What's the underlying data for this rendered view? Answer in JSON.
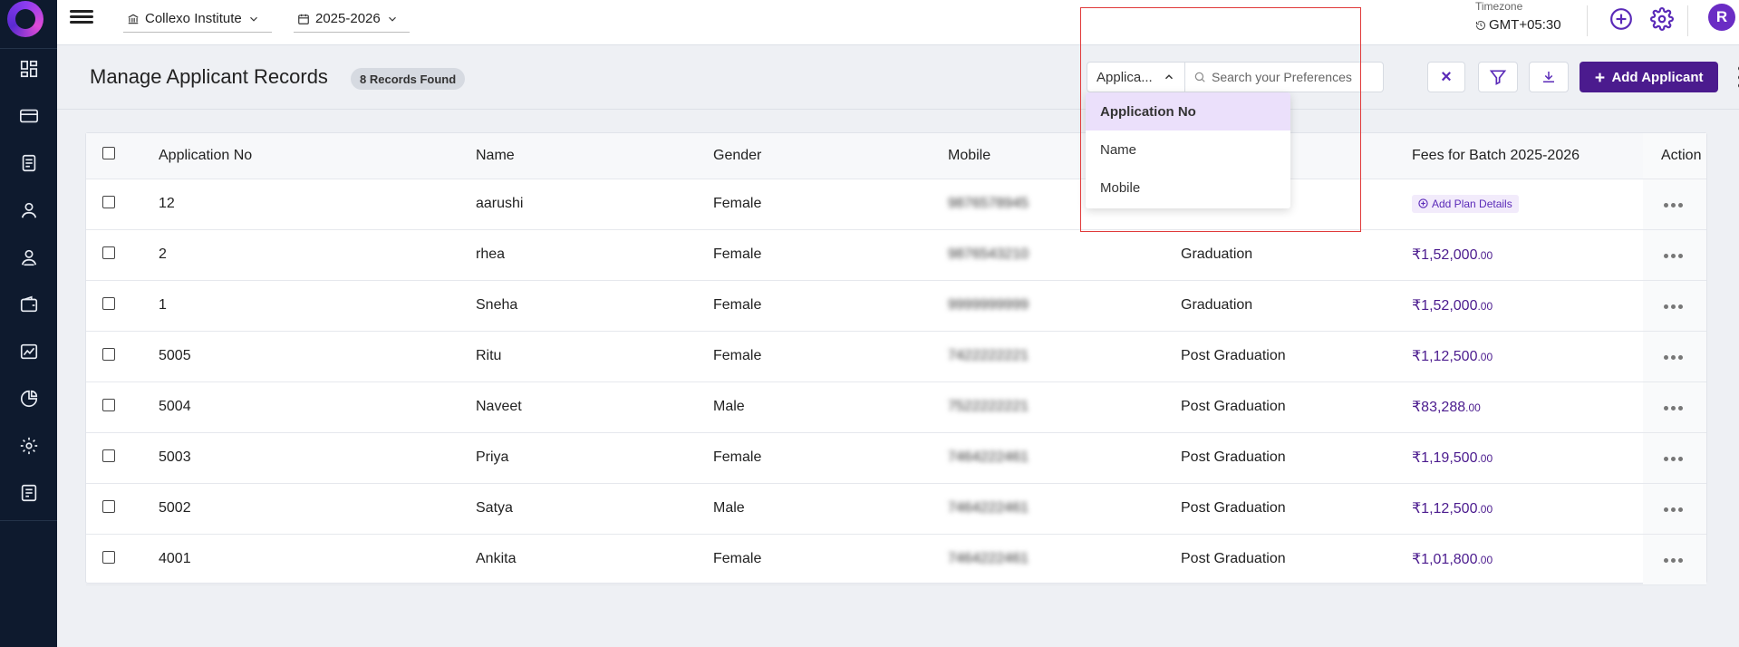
{
  "topbar": {
    "institute": "Collexo Institute",
    "year": "2025-2026",
    "timezone_label": "Timezone",
    "timezone_value": "GMT+05:30",
    "avatar_initial": "R"
  },
  "header": {
    "title": "Manage Applicant Records",
    "records_badge": "8 Records Found",
    "search_field_selected": "Applica...",
    "search_placeholder": "Search your Preferences",
    "clear_label": "×",
    "add_label": "Add Applicant"
  },
  "dropdown": {
    "options": [
      "Application No",
      "Name",
      "Mobile"
    ]
  },
  "table": {
    "columns": [
      "Application No",
      "Name",
      "Gender",
      "Mobile",
      "",
      "Fees for Batch 2025-2026",
      "Action"
    ],
    "rows": [
      {
        "app_no": "12",
        "name": "aarushi",
        "gender": "Female",
        "mobile": "9876578945",
        "course": "",
        "fee_main": "",
        "fee_dec": "",
        "plan": "Add Plan Details"
      },
      {
        "app_no": "2",
        "name": "rhea",
        "gender": "Female",
        "mobile": "9876543210",
        "course": "Graduation",
        "fee_main": "₹1,52,000",
        "fee_dec": ".00",
        "plan": ""
      },
      {
        "app_no": "1",
        "name": "Sneha",
        "gender": "Female",
        "mobile": "9999999999",
        "course": "Graduation",
        "fee_main": "₹1,52,000",
        "fee_dec": ".00",
        "plan": ""
      },
      {
        "app_no": "5005",
        "name": "Ritu",
        "gender": "Female",
        "mobile": "7422222221",
        "course": "Post Graduation",
        "fee_main": "₹1,12,500",
        "fee_dec": ".00",
        "plan": ""
      },
      {
        "app_no": "5004",
        "name": "Naveet",
        "gender": "Male",
        "mobile": "7522222221",
        "course": "Post Graduation",
        "fee_main": "₹83,288",
        "fee_dec": ".00",
        "plan": ""
      },
      {
        "app_no": "5003",
        "name": "Priya",
        "gender": "Female",
        "mobile": "7464222461",
        "course": "Post Graduation",
        "fee_main": "₹1,19,500",
        "fee_dec": ".00",
        "plan": ""
      },
      {
        "app_no": "5002",
        "name": "Satya",
        "gender": "Male",
        "mobile": "7464222461",
        "course": "Post Graduation",
        "fee_main": "₹1,12,500",
        "fee_dec": ".00",
        "plan": ""
      },
      {
        "app_no": "4001",
        "name": "Ankita",
        "gender": "Female",
        "mobile": "7464222461",
        "course": "Post Graduation",
        "fee_main": "₹1,01,800",
        "fee_dec": ".00",
        "plan": ""
      }
    ]
  },
  "colors": {
    "sidebar_bg": "#0e1a2e",
    "accent": "#4b1b8e",
    "highlight": "#e03a3a"
  },
  "sidebar_icons": [
    "dashboard-icon",
    "card-icon",
    "document-icon",
    "user-icon",
    "teacher-icon",
    "wallet-icon",
    "image-chart-icon",
    "pie-chart-icon",
    "settings-icon",
    "report-icon"
  ]
}
